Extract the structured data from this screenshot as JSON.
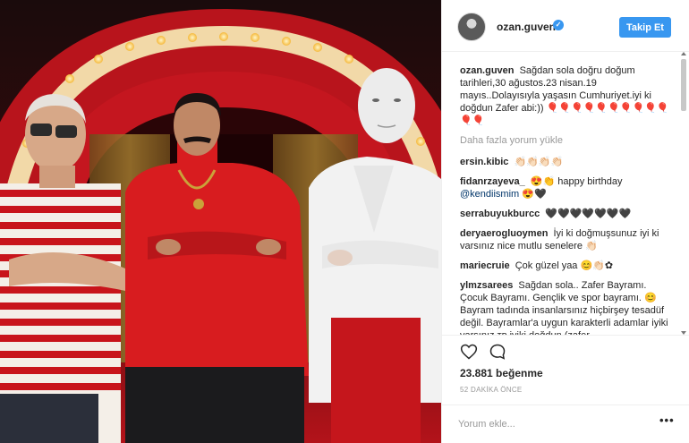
{
  "header": {
    "username": "ozan.guven",
    "verified_icon": "verified-badge-icon",
    "follow_label": "Takip Et",
    "accent": "#3897f0"
  },
  "comments": {
    "caption": {
      "author": "ozan.guven",
      "text": "Sağdan sola doğru doğum tarihleri,30 ağustos.23 nisan.19 mayıs..Dolayısıyla yaşasın Cumhuriyet.iyi ki doğdun Zafer abi:)) 🎈🎈🎈🎈🎈🎈🎈🎈🎈🎈🎈🎈"
    },
    "load_more": "Daha fazla yorum yükle",
    "items": [
      {
        "author": "ersin.kibic",
        "text": "👏🏻👏🏻👏🏻👏🏻"
      },
      {
        "author": "fidanrzayeva_",
        "text": "😍👏 happy birthday",
        "mention": "@kendiismim",
        "tail": " 😍🖤"
      },
      {
        "author": "serrabuyukburcc",
        "text": "🖤🖤🖤🖤🖤🖤🖤"
      },
      {
        "author": "deryaerogluoymen",
        "text": "İyi ki doğmuşsunuz iyi ki varsınız nice mutlu senelere 👏🏻"
      },
      {
        "author": "mariecruie",
        "text": "Çok güzel yaa 😊👏🏻✿"
      },
      {
        "author": "ylmzsarees",
        "text": "Sağdan sola.. Zafer Bayramı. Çocuk Bayramı. Gençlik ve spor bayramı. 😊 Bayram tadında insanlarsınız hiçbirşey tesadüf değil. Bayramlar'a uygun karakterli adamlar iyiki varsınız ᴛʀ iyiki doğdun (zafer"
      }
    ]
  },
  "actions": {
    "like_icon": "heart-icon",
    "comment_icon": "comment-bubble-icon",
    "likes": "23.881 beğenme",
    "timestamp": "52 DAKİKA ÖNCE"
  },
  "add_comment": {
    "placeholder": "Yorum ekle...",
    "more_icon": "more-dots-icon",
    "more_label": "•••"
  },
  "photo": {
    "description_icon": "post-photo"
  }
}
